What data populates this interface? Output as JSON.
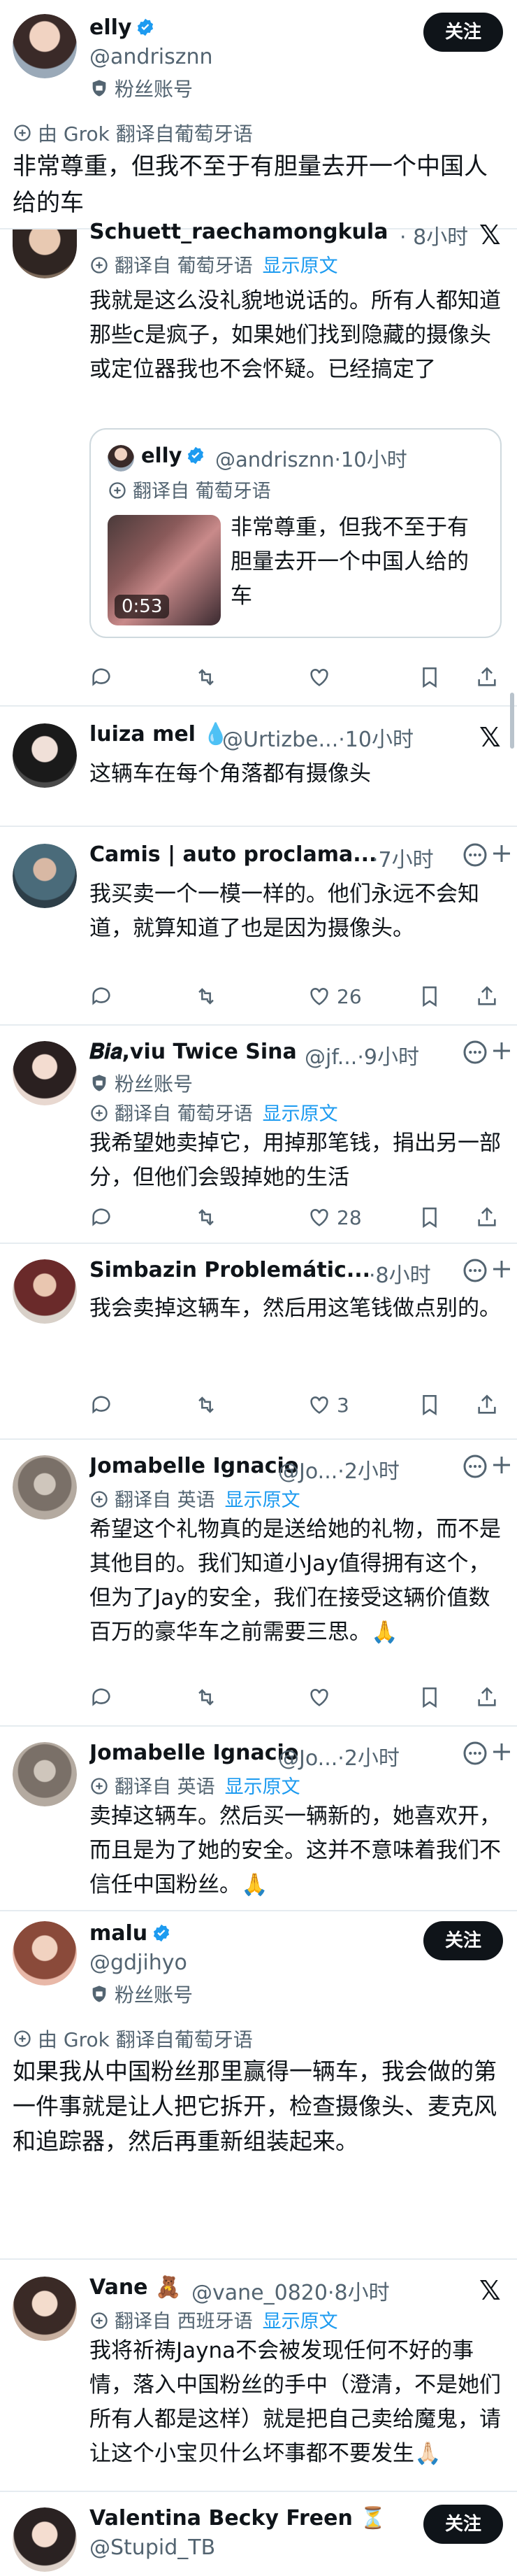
{
  "colors": {
    "accent": "#1d9bf0",
    "muted": "#536471",
    "text": "#0f1419",
    "border": "#cfd9de"
  },
  "top_post": {
    "name": "elly",
    "handle": "@andrisznn",
    "fan_badge": "粉丝账号",
    "follow": "关注",
    "translated_by": "由 Grok 翻译自葡萄牙语",
    "text": "非常尊重，但我不至于有胆量去开一个中国人给的车"
  },
  "replies": [
    {
      "name": "Schuett_raechamongkula...",
      "time": "8小时",
      "translated": "翻译自 葡萄牙语",
      "show_original": "显示原文",
      "text": "我就是这么没礼貌地说话的。所有人都知道那些c是疯子，如果她们找到隐藏的摄像头或定位器我也不会怀疑。已经搞定了",
      "quote": {
        "name": "elly",
        "handle": "@andrisznn",
        "time": "10小时",
        "translated": "翻译自 葡萄牙语",
        "text": "非常尊重，但我不至于有胆量去开一个中国人给的车",
        "video_time": "0:53"
      }
    },
    {
      "name": "luiza mel",
      "handle": "@Urtizbe...",
      "time": "10小时",
      "text": "这辆车在每个角落都有摄像头"
    },
    {
      "name": "Camis | auto proclama...",
      "time": "7小时",
      "text": "我买卖一个一模一样的。他们永远不会知道，就算知道了也是因为摄像头。",
      "likes": "26"
    },
    {
      "name": "𝑩𝒊𝒂,viu Twice Sina",
      "handle": "@jf...",
      "time": "9小时",
      "fan_badge": "粉丝账号",
      "translated": "翻译自 葡萄牙语",
      "show_original": "显示原文",
      "text": "我希望她卖掉它，用掉那笔钱，捐出另一部分，但他们会毁掉她的生活",
      "likes": "28"
    },
    {
      "name": "Simbazin Problemátic...",
      "time": "8小时",
      "text": "我会卖掉这辆车，然后用这笔钱做点别的。",
      "likes": "3"
    },
    {
      "name": "Jomabelle Ignacio",
      "handle": "@Jo...",
      "time": "2小时",
      "translated": "翻译自 英语",
      "show_original": "显示原文",
      "text": "希望这个礼物真的是送给她的礼物，而不是其他目的。我们知道小Jay值得拥有这个，但为了Jay的安全，我们在接受这辆价值数百万的豪华车之前需要三思。🙏"
    },
    {
      "name": "Jomabelle Ignacio",
      "handle": "@Jo...",
      "time": "2小时",
      "translated": "翻译自 英语",
      "show_original": "显示原文",
      "text": "卖掉这辆车。然后买一辆新的，她喜欢开，而且是为了她的安全。这并不意味着我们不信任中国粉丝。🙏"
    }
  ],
  "malu_post": {
    "name": "malu",
    "handle": "@gdjihyo",
    "fan_badge": "粉丝账号",
    "follow": "关注",
    "translated_by": "由 Grok 翻译自葡萄牙语",
    "text": "如果我从中国粉丝那里赢得一辆车，我会做的第一件事就是让人把它拆开，检查摄像头、麦克风和追踪器，然后再重新组装起来。"
  },
  "vane_reply": {
    "name": "Vane 🧸",
    "handle": "@vane_0820",
    "time": "8小时",
    "translated": "翻译自 西班牙语",
    "show_original": "显示原文",
    "text": "我将祈祷Jayna不会被发现任何不好的事情，落入中国粉丝的手中（澄清，不是她们所有人都是这样）就是把自己卖给魔鬼，请让这个小宝贝什么坏事都不要发生🙏🏻"
  },
  "last_post": {
    "name": "Valentina Becky Freen ⏳",
    "handle": "@Stupid_TB",
    "follow": "关注"
  }
}
